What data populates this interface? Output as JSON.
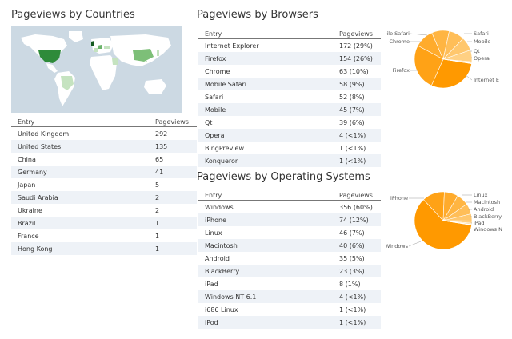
{
  "countries": {
    "title": "Pageviews by Countries",
    "col_entry": "Entry",
    "col_pageviews": "Pageviews",
    "rows": [
      {
        "entry": "United Kingdom",
        "value": "292"
      },
      {
        "entry": "United States",
        "value": "135"
      },
      {
        "entry": "China",
        "value": "65"
      },
      {
        "entry": "Germany",
        "value": "41"
      },
      {
        "entry": "Japan",
        "value": "5"
      },
      {
        "entry": "Saudi Arabia",
        "value": "2"
      },
      {
        "entry": "Ukraine",
        "value": "2"
      },
      {
        "entry": "Brazil",
        "value": "1"
      },
      {
        "entry": "France",
        "value": "1"
      },
      {
        "entry": "Hong Kong",
        "value": "1"
      }
    ]
  },
  "browsers": {
    "title": "Pageviews by Browsers",
    "col_entry": "Entry",
    "col_pageviews": "Pageviews",
    "rows": [
      {
        "entry": "Internet Explorer",
        "value": "172 (29%)"
      },
      {
        "entry": "Firefox",
        "value": "154 (26%)"
      },
      {
        "entry": "Chrome",
        "value": "63 (10%)"
      },
      {
        "entry": "Mobile Safari",
        "value": "58 (9%)"
      },
      {
        "entry": "Safari",
        "value": "52 (8%)"
      },
      {
        "entry": "Mobile",
        "value": "45 (7%)"
      },
      {
        "entry": "Qt",
        "value": "39 (6%)"
      },
      {
        "entry": "Opera",
        "value": "4 (<1%)"
      },
      {
        "entry": "BingPreview",
        "value": "1 (<1%)"
      },
      {
        "entry": "Konqueror",
        "value": "1 (<1%)"
      }
    ],
    "pie_labels": [
      "bile Safari",
      "Chrome",
      "Firefox",
      "Safari",
      "Mobile",
      "Qt",
      "Opera",
      "Internet E"
    ]
  },
  "os": {
    "title": "Pageviews by Operating Systems",
    "col_entry": "Entry",
    "col_pageviews": "Pageviews",
    "rows": [
      {
        "entry": "Windows",
        "value": "356 (60%)"
      },
      {
        "entry": "iPhone",
        "value": "74 (12%)"
      },
      {
        "entry": "Linux",
        "value": "46 (7%)"
      },
      {
        "entry": "Macintosh",
        "value": "40 (6%)"
      },
      {
        "entry": "Android",
        "value": "35 (5%)"
      },
      {
        "entry": "BlackBerry",
        "value": "23 (3%)"
      },
      {
        "entry": "iPad",
        "value": "8 (1%)"
      },
      {
        "entry": "Windows NT 6.1",
        "value": "4 (<1%)"
      },
      {
        "entry": "i686 Linux",
        "value": "1 (<1%)"
      },
      {
        "entry": "iPod",
        "value": "1 (<1%)"
      }
    ],
    "pie_labels": [
      "iPhone",
      "Windows",
      "Linux",
      "Macintosh",
      "Android",
      "BlackBerry",
      "iPad",
      "Windows N"
    ]
  },
  "chart_data": [
    {
      "type": "pie",
      "categories": [
        "Internet Explorer",
        "Firefox",
        "Chrome",
        "Mobile Safari",
        "Safari",
        "Mobile",
        "Qt",
        "Opera",
        "BingPreview",
        "Konqueror"
      ],
      "values": [
        172,
        154,
        63,
        58,
        52,
        45,
        39,
        4,
        1,
        1
      ]
    },
    {
      "type": "pie",
      "categories": [
        "Windows",
        "iPhone",
        "Linux",
        "Macintosh",
        "Android",
        "BlackBerry",
        "iPad",
        "Windows NT 6.1",
        "i686 Linux",
        "iPod"
      ],
      "values": [
        356,
        74,
        46,
        40,
        35,
        23,
        8,
        4,
        1,
        1
      ]
    }
  ],
  "colors": {
    "pie_dark": "#ff9900",
    "pie_light": "#ffe4b3",
    "map_highlight": "#2e8b3a",
    "map_land": "#ffffff",
    "map_water": "#ccd9e3"
  }
}
